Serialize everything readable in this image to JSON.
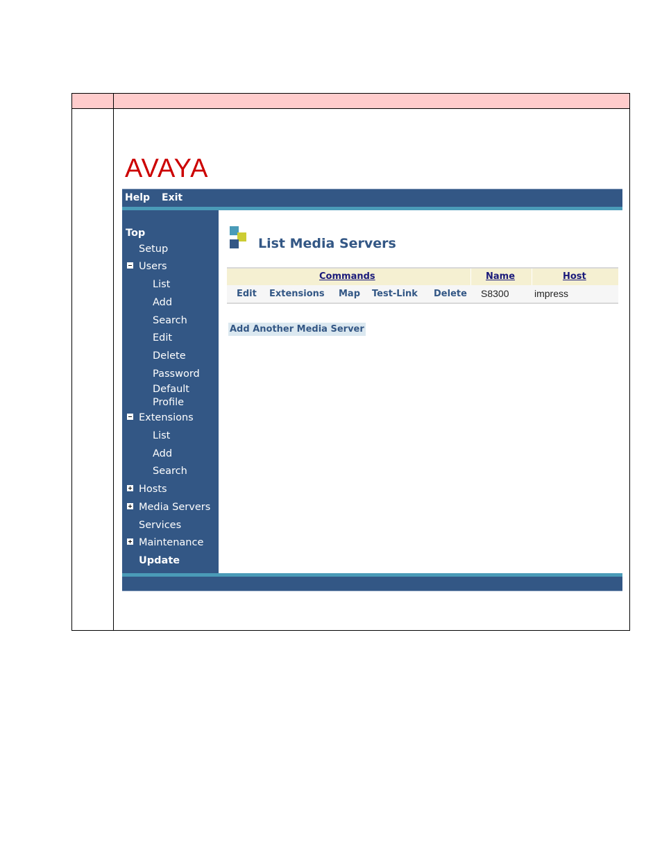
{
  "brand": {
    "logo_text": "AVAYA",
    "colors": {
      "logo_red": "#cc0000",
      "nav_blue": "#335785",
      "stripe_teal": "#4a9bb8",
      "header_pink": "#ffcccc",
      "table_header_bg": "#f5f0d2"
    }
  },
  "topbar": {
    "items": [
      {
        "label": "Help"
      },
      {
        "label": "Exit"
      }
    ]
  },
  "sidebar": {
    "items": [
      {
        "label": "Top",
        "level": 0,
        "bold": true
      },
      {
        "label": "Setup",
        "level": 1
      },
      {
        "label": "Users",
        "level": 1,
        "toggle": "minus-icon"
      },
      {
        "label": "List",
        "level": 2
      },
      {
        "label": "Add",
        "level": 2
      },
      {
        "label": "Search",
        "level": 2
      },
      {
        "label": "Edit",
        "level": 2
      },
      {
        "label": "Delete",
        "level": 2
      },
      {
        "label": "Password",
        "level": 2
      },
      {
        "label": "Default",
        "level": 2
      },
      {
        "label": "Profile",
        "level": 2
      },
      {
        "label": "Extensions",
        "level": 1,
        "toggle": "minus-icon"
      },
      {
        "label": "List",
        "level": 2
      },
      {
        "label": "Add",
        "level": 2
      },
      {
        "label": "Search",
        "level": 2
      },
      {
        "label": "Hosts",
        "level": 1,
        "toggle": "plus-icon"
      },
      {
        "label": "Media Servers",
        "level": 1,
        "toggle": "plus-icon"
      },
      {
        "label": "Services",
        "level": 1
      },
      {
        "label": "Maintenance",
        "level": 1,
        "toggle": "plus-icon"
      },
      {
        "label": "Update",
        "level": 1,
        "bold": true
      }
    ]
  },
  "main": {
    "title": "List Media Servers",
    "table": {
      "headers": [
        "Commands",
        "Name",
        "Host"
      ],
      "rows": [
        {
          "commands": [
            "Edit",
            "Extensions",
            "Map",
            "Test-Link",
            "Delete"
          ],
          "name": "S8300",
          "host": "impress"
        }
      ]
    },
    "add_link": "Add Another Media Server"
  }
}
